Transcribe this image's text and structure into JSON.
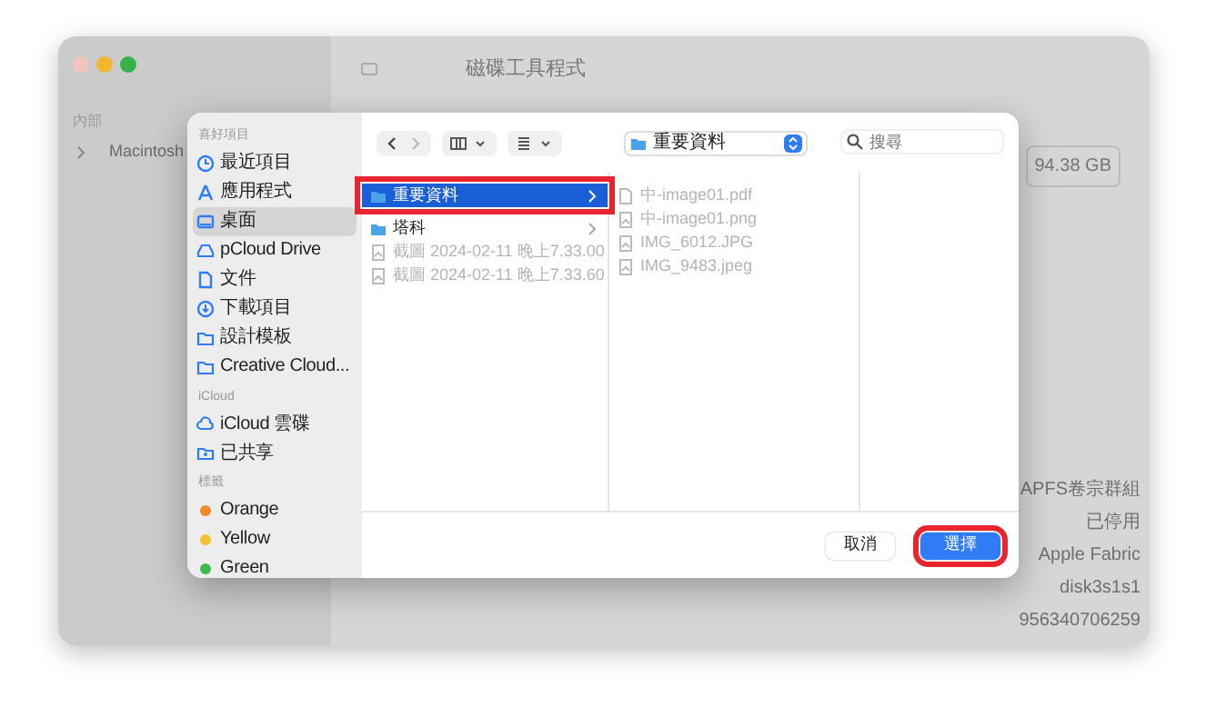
{
  "background_window": {
    "title": "磁碟工具程式",
    "sidebar_heading": "內部",
    "sidebar_items": [
      {
        "label": "Macintosh"
      }
    ],
    "capacity": "94.38 GB",
    "info": [
      "APFS卷宗群組",
      "已停用",
      "Apple Fabric",
      "disk3s1s1",
      "956340706259"
    ]
  },
  "dialog": {
    "location": "重要資料",
    "search": {
      "placeholder": "搜尋"
    },
    "sidebar": [
      {
        "heading": "喜好項目",
        "items": [
          {
            "label": "最近項目",
            "kind": "clock",
            "selected": false
          },
          {
            "label": "應用程式",
            "kind": "apps",
            "selected": false
          },
          {
            "label": "桌面",
            "kind": "desktop",
            "selected": true
          },
          {
            "label": "pCloud Drive",
            "kind": "drive",
            "selected": false
          },
          {
            "label": "文件",
            "kind": "doc",
            "selected": false
          },
          {
            "label": "下載項目",
            "kind": "download",
            "selected": false
          },
          {
            "label": "設計模板",
            "kind": "folder",
            "selected": false
          },
          {
            "label": "Creative Cloud...",
            "kind": "folder",
            "selected": false
          }
        ]
      },
      {
        "heading": "iCloud",
        "items": [
          {
            "label": "iCloud 雲碟",
            "kind": "cloud",
            "selected": false
          },
          {
            "label": "已共享",
            "kind": "shared",
            "selected": false
          }
        ]
      },
      {
        "heading": "標籤",
        "items": [
          {
            "label": "Orange",
            "kind": "tag",
            "color": "#f0892a",
            "selected": false
          },
          {
            "label": "Yellow",
            "kind": "tag",
            "color": "#f2c230",
            "selected": false
          },
          {
            "label": "Green",
            "kind": "tag",
            "color": "#3dbb4e",
            "selected": false
          }
        ]
      }
    ],
    "columns": [
      [
        {
          "name": "重要資料",
          "kind": "folder",
          "selected": true,
          "disabled": false,
          "highlighted": true
        },
        {
          "name": "塔科",
          "kind": "folder",
          "selected": false,
          "disabled": false,
          "highlighted": false
        },
        {
          "name": "截圖 2024-02-11 晚上7.33.00",
          "kind": "image",
          "selected": false,
          "disabled": true,
          "highlighted": false
        },
        {
          "name": "截圖 2024-02-11 晚上7.33.60",
          "kind": "image",
          "selected": false,
          "disabled": true,
          "highlighted": false
        }
      ],
      [
        {
          "name": "中-image01.pdf",
          "kind": "pdf",
          "selected": false,
          "disabled": true,
          "highlighted": false
        },
        {
          "name": "中-image01.png",
          "kind": "image",
          "selected": false,
          "disabled": true,
          "highlighted": false
        },
        {
          "name": "IMG_6012.JPG",
          "kind": "image",
          "selected": false,
          "disabled": true,
          "highlighted": false
        },
        {
          "name": "IMG_9483.jpeg",
          "kind": "image",
          "selected": false,
          "disabled": true,
          "highlighted": false
        }
      ]
    ],
    "buttons": [
      {
        "label": "取消",
        "kind": "cancel",
        "highlighted": false
      },
      {
        "label": "選擇",
        "kind": "default",
        "highlighted": true
      }
    ]
  }
}
